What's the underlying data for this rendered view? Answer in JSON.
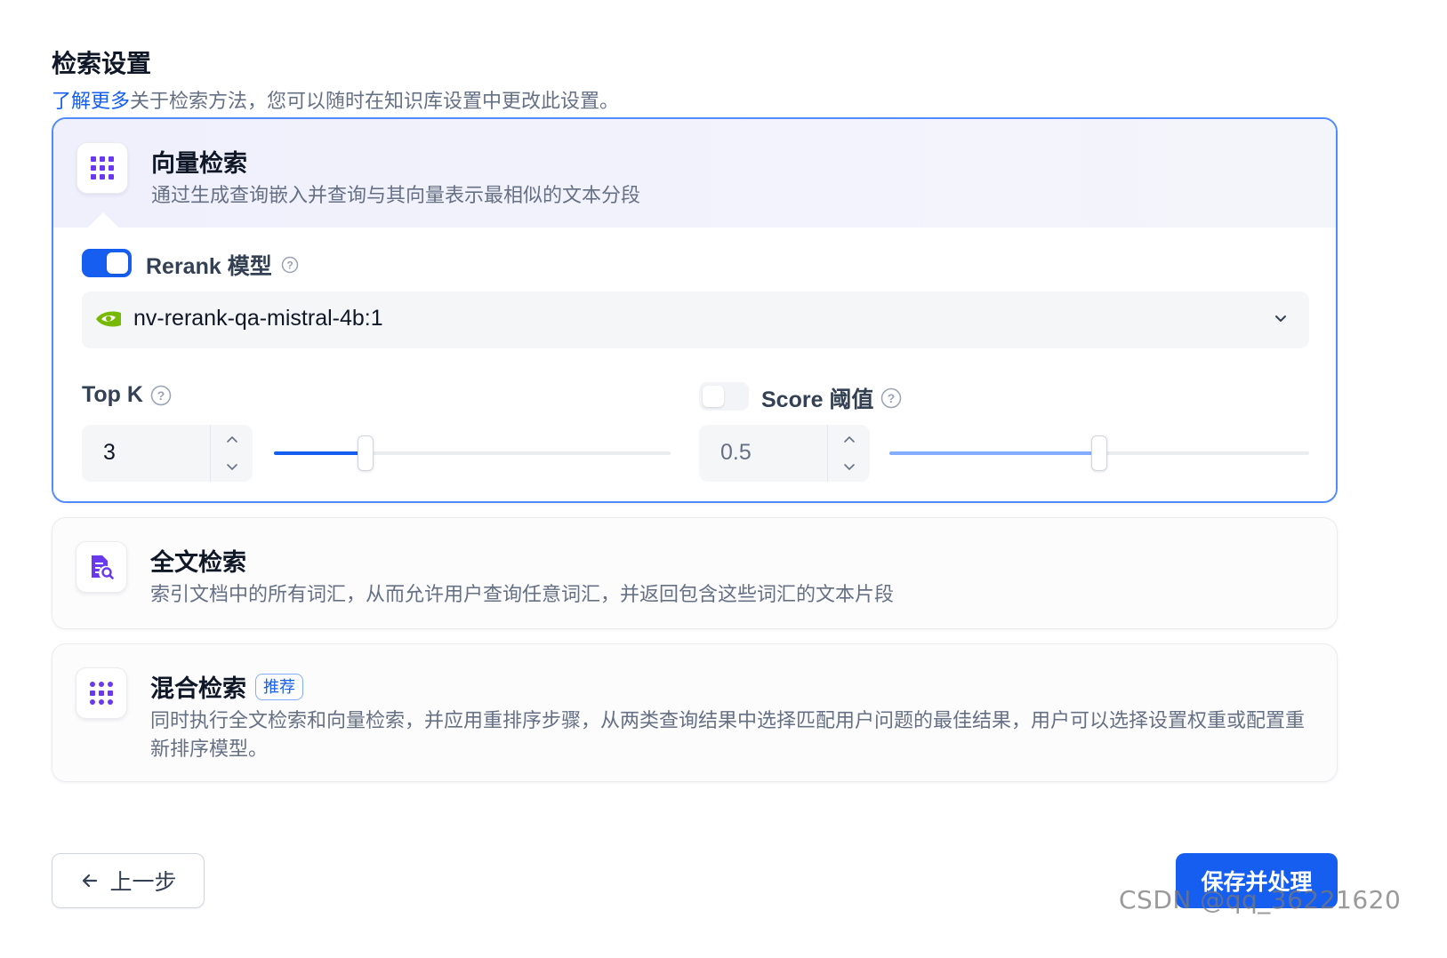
{
  "header": {
    "title": "检索设置",
    "link_text": "了解更多",
    "description": "关于检索方法，您可以随时在知识库设置中更改此设置。"
  },
  "vector_search": {
    "name": "向量检索",
    "description": "通过生成查询嵌入并查询与其向量表示最相似的文本分段",
    "icon": "vector-grid-icon",
    "selected": true,
    "rerank": {
      "enabled": true,
      "label": "Rerank 模型",
      "model_name": "nv-rerank-qa-mistral-4b:1",
      "model_icon": "nvidia-icon"
    },
    "top_k": {
      "label": "Top K",
      "value": "3",
      "slider_fraction": 0.23
    },
    "score_threshold": {
      "enabled": false,
      "label": "Score 阈值",
      "value": "0.5",
      "slider_fraction": 0.5
    }
  },
  "full_text_search": {
    "name": "全文检索",
    "description": "索引文档中的所有词汇，从而允许用户查询任意词汇，并返回包含这些词汇的文本片段",
    "icon": "document-search-icon"
  },
  "hybrid_search": {
    "name": "混合检索",
    "badge": "推荐",
    "description": "同时执行全文检索和向量检索，并应用重排序步骤，从两类查询结果中选择匹配用户问题的最佳结果，用户可以选择设置权重或配置重新排序模型。",
    "icon": "hybrid-grid-icon"
  },
  "footer": {
    "back_label": "上一步",
    "save_label": "保存并处理"
  },
  "watermark": "CSDN @qq_36221620",
  "colors": {
    "primary": "#155eef",
    "active_border": "#528bff",
    "icon_purple": "#6938ef"
  }
}
